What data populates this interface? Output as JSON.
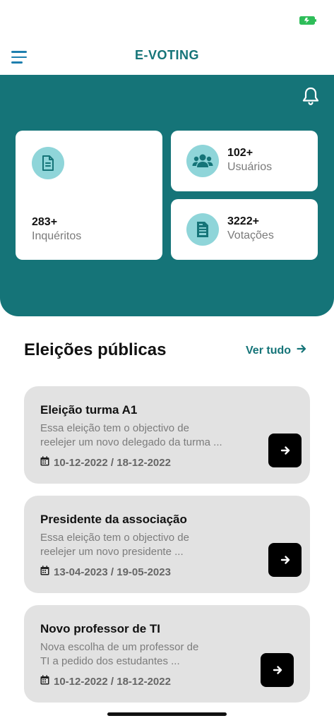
{
  "app": {
    "title": "E-VOTING"
  },
  "icons": {
    "menu": "menu-icon",
    "bell": "bell-icon",
    "document": "document-icon",
    "users": "users-icon",
    "ballot": "ballot-icon",
    "arrow": "arrow-right-icon",
    "calendar": "calendar-icon",
    "battery": "battery-icon"
  },
  "colors": {
    "primary": "#157478",
    "icon_bg": "#8fd5d9",
    "card_bg": "#e2e2e2",
    "menu": "#1e7fae",
    "battery": "#2ebd59"
  },
  "stats": {
    "inquiries": {
      "value": "283+",
      "label": "Inquéritos"
    },
    "users": {
      "value": "102+",
      "label": "Usuários"
    },
    "votes": {
      "value": "3222+",
      "label": "Votações"
    }
  },
  "section": {
    "title": "Eleições públicas",
    "see_all": "Ver tudo"
  },
  "elections": [
    {
      "title": "Eleição turma A1",
      "description": "Essa eleição tem o objectivo de\nreelejer um novo delegado da turma ...",
      "dates": "10-12-2022 / 18-12-2022"
    },
    {
      "title": "Presidente da associação",
      "description": "Essa eleição tem o objectivo de\nreelejer um novo presidente  ...",
      "dates": "13-04-2023 / 19-05-2023"
    },
    {
      "title": "Novo professor de TI",
      "description": " Nova escolha de um professor de\nTI a pedido dos estudantes ...",
      "dates": "10-12-2022 / 18-12-2022"
    }
  ]
}
